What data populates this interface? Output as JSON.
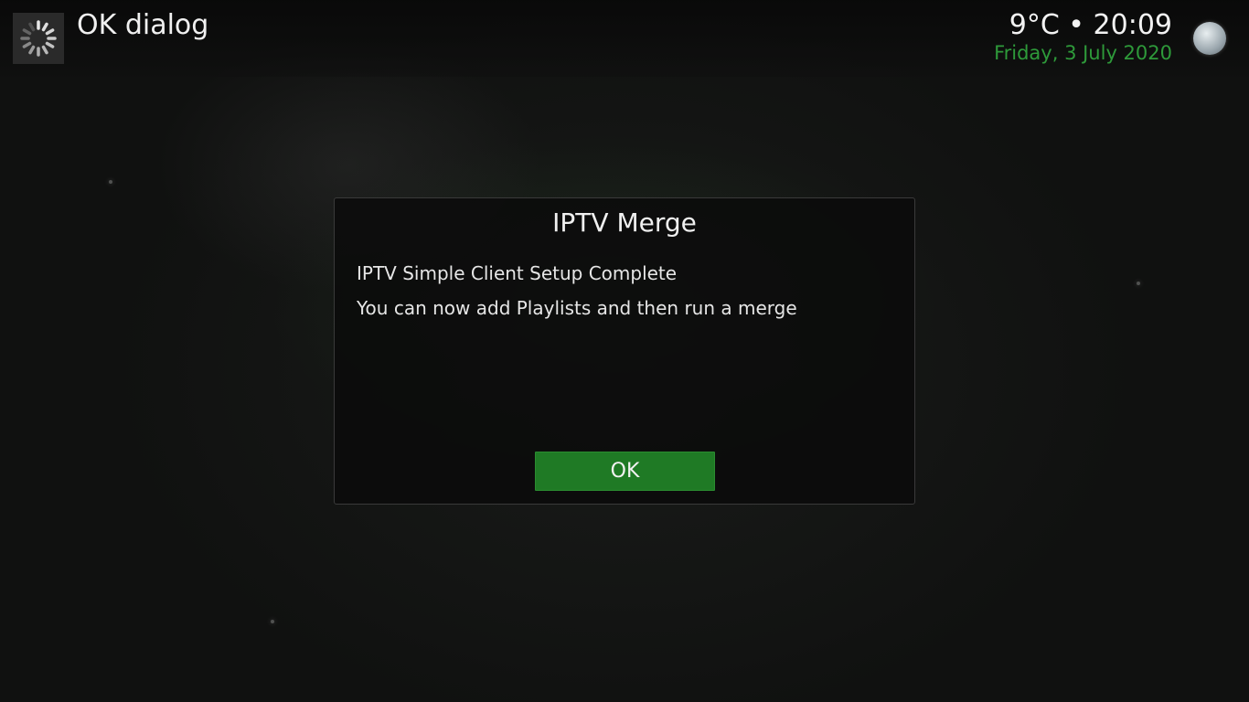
{
  "header": {
    "window_title": "OK dialog",
    "spinner_icon": "busy-spinner-icon",
    "weather_time": "9°C • 20:09",
    "date": "Friday, 3 July 2020",
    "weather_icon": "moon-icon"
  },
  "dialog": {
    "title": "IPTV Merge",
    "lines": [
      "IPTV Simple Client Setup Complete",
      "You can now add Playlists and then run a merge"
    ],
    "ok_label": "OK"
  },
  "colors": {
    "accent": "#1f7a25",
    "date_text": "#2e9a3a"
  }
}
